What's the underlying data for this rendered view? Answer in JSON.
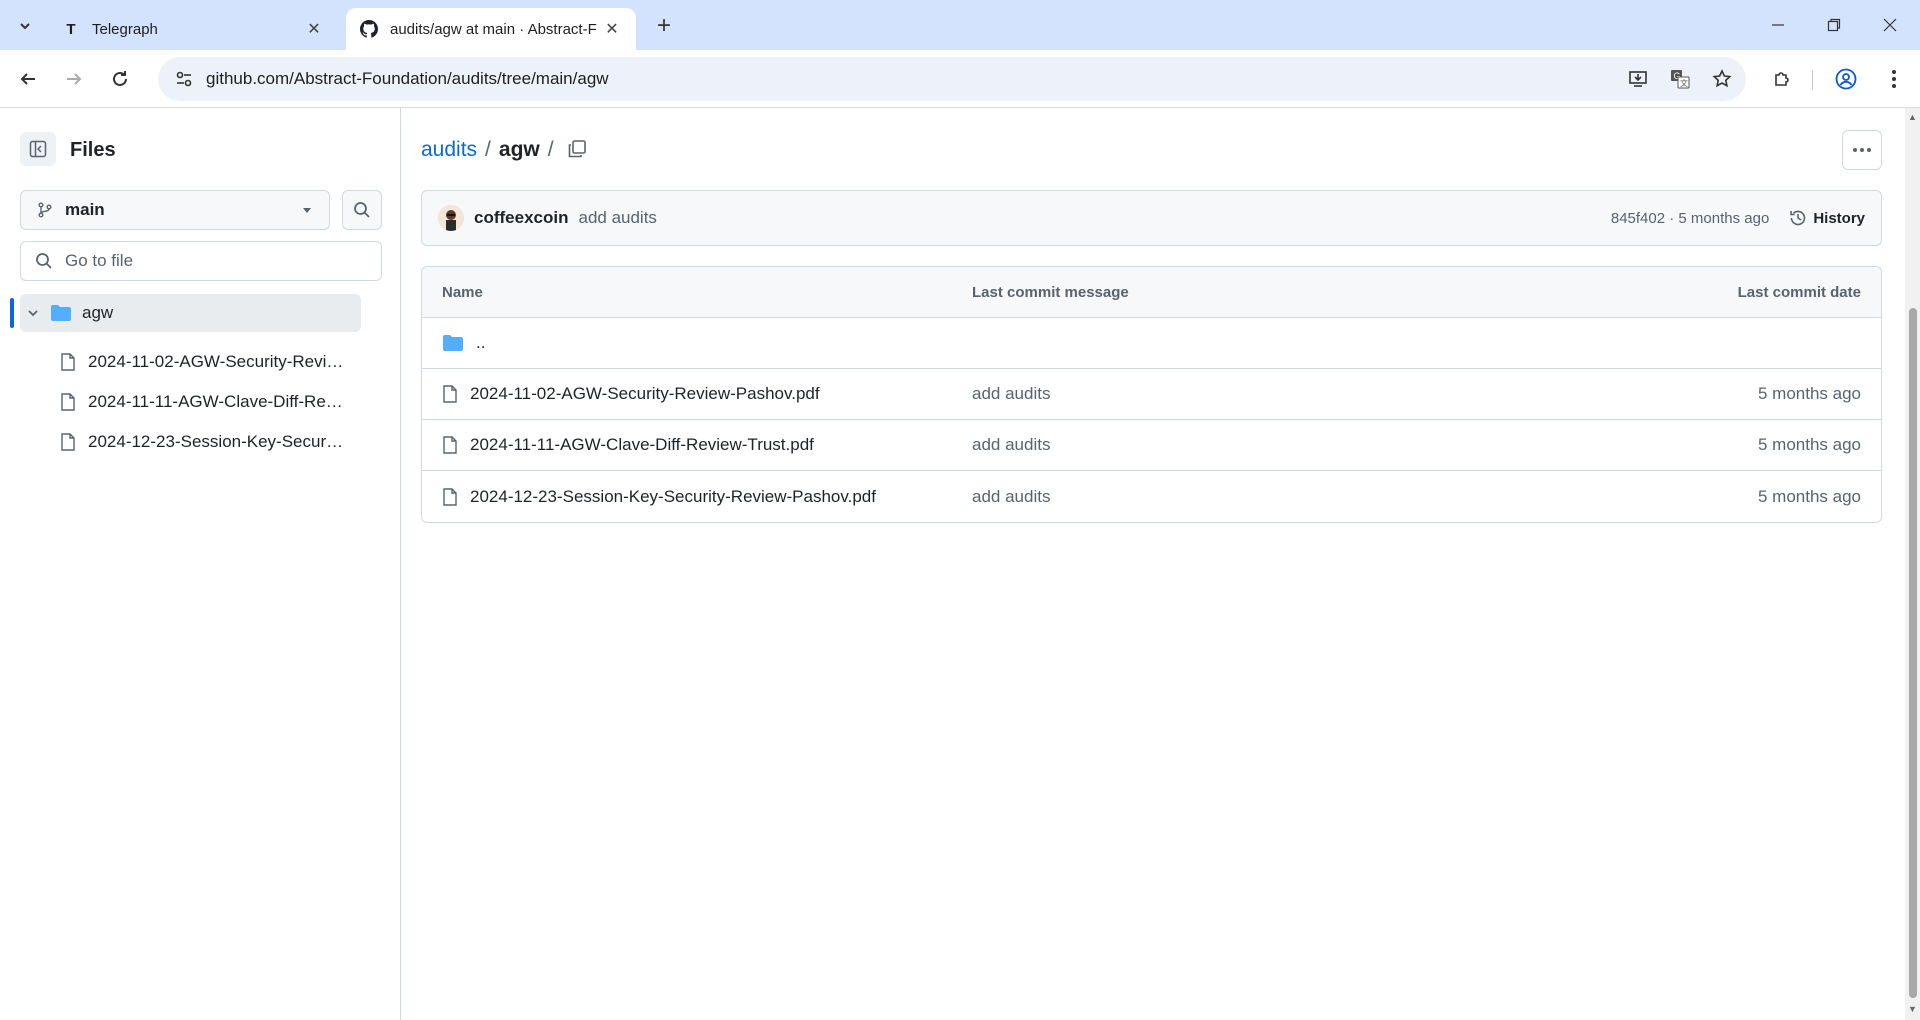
{
  "browser": {
    "tabs": [
      {
        "title": "Telegraph",
        "favicon": "T"
      },
      {
        "title": "audits/agw at main · Abstract-F"
      }
    ],
    "url": "github.com/Abstract-Foundation/audits/tree/main/agw"
  },
  "sidebar": {
    "title": "Files",
    "branch": "main",
    "goto_placeholder": "Go to file",
    "folder": "agw",
    "files": [
      "2024-11-02-AGW-Security-Review-Pashov.pdf",
      "2024-11-11-AGW-Clave-Diff-Review-Trust.pdf",
      "2024-12-23-Session-Key-Security-Review-Pashov.pdf"
    ]
  },
  "main": {
    "breadcrumb": {
      "repo": "audits",
      "sep": "/",
      "dir": "agw",
      "trail": "/"
    },
    "commit": {
      "author": "coffeexcoin",
      "message": "add audits",
      "meta": "845f402 · 5 months ago",
      "history_label": "History"
    },
    "table": {
      "headers": {
        "name": "Name",
        "message": "Last commit message",
        "date": "Last commit date"
      },
      "parent": "..",
      "rows": [
        {
          "name": "2024-11-02-AGW-Security-Review-Pashov.pdf",
          "message": "add audits",
          "date": "5 months ago"
        },
        {
          "name": "2024-11-11-AGW-Clave-Diff-Review-Trust.pdf",
          "message": "add audits",
          "date": "5 months ago"
        },
        {
          "name": "2024-12-23-Session-Key-Security-Review-Pashov.pdf",
          "message": "add audits",
          "date": "5 months ago"
        }
      ]
    }
  },
  "colors": {
    "link": "#0969da",
    "tabstrip": "#d3e3fd",
    "omnibox": "#edf2fa"
  }
}
